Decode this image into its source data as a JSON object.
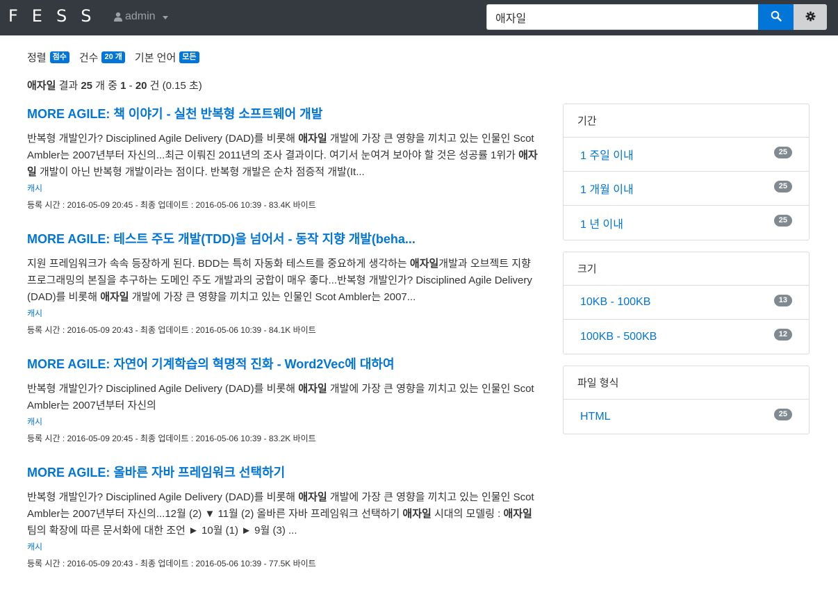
{
  "header": {
    "logo": "FESS",
    "user": "admin",
    "search_value": "애자일"
  },
  "filters": [
    {
      "label": "정렬",
      "badge": "점수"
    },
    {
      "label": "건수",
      "badge": "20 개"
    },
    {
      "label": "기본 언어",
      "badge": "모든"
    }
  ],
  "summary": {
    "query": "애자일",
    "text1": " 결과 ",
    "total": "25",
    "text2": " 개 중 ",
    "start": "1",
    "text3": " - ",
    "end": "20",
    "text4": " 건 (0.15 초)"
  },
  "results": [
    {
      "title": "MORE AGILE: 책 이야기 - 실천 반복형 소프트웨어 개발",
      "snippet": [
        {
          "t": "반복형 개발인가? Disciplined Agile Delivery (DAD)를 비롯해 "
        },
        {
          "t": "애자일",
          "b": true
        },
        {
          "t": " 개발에 가장 큰 영향을 끼치고 있는 인물인 Scot Ambler는 2007년부터 자신의...최근 이뤄진 2011년의 조사 결과이다. 여기서 눈여겨 보아야 할 것은 성공률 1위가 "
        },
        {
          "t": "애자일",
          "b": true
        },
        {
          "t": " 개발이 아닌 반복형 개발이라는 점이다. 반복형 개발은 순차 점증적 개발(It..."
        }
      ],
      "cache": "캐시",
      "meta": "등록 시간 : 2016-05-09 20:45 - 최종 업데이트 : 2016-05-06 10:39 - 83.4K 바이트"
    },
    {
      "title": "MORE AGILE: 테스트 주도 개발(TDD)을 넘어서 - 동작 지향 개발(beha...",
      "snippet": [
        {
          "t": "지원 프레임워크가 속속 등장하게 된다. BDD는 특히 자동화 테스트를 중요하게 생각하는 "
        },
        {
          "t": "애자일",
          "b": true
        },
        {
          "t": "개발과 오브젝트 지향 프로그래밍의 본질을 추구하는 도메인 주도 개발과의 궁합이 매우 좋다...반복형 개발인가? Disciplined Agile Delivery (DAD)를 비롯해 "
        },
        {
          "t": "애자일",
          "b": true
        },
        {
          "t": " 개발에 가장 큰 영향을 끼치고 있는 인물인 Scot Ambler는 2007..."
        }
      ],
      "cache": "캐시",
      "meta": "등록 시간 : 2016-05-09 20:43 - 최종 업데이트 : 2016-05-06 10:39 - 84.1K 바이트"
    },
    {
      "title": "MORE AGILE: 자연어 기계학습의 혁명적 진화 - Word2Vec에 대하여",
      "snippet": [
        {
          "t": "반복형 개발인가? Disciplined Agile Delivery (DAD)를 비롯해 "
        },
        {
          "t": "애자일",
          "b": true
        },
        {
          "t": " 개발에 가장 큰 영향을 끼치고 있는 인물인 Scot Ambler는 2007년부터 자신의"
        }
      ],
      "cache": "캐시",
      "meta": "등록 시간 : 2016-05-09 20:45 - 최종 업데이트 : 2016-05-06 10:39 - 83.2K 바이트"
    },
    {
      "title": "MORE AGILE: 올바른 자바 프레임워크 선택하기",
      "snippet": [
        {
          "t": "반복형 개발인가? Disciplined Agile Delivery (DAD)를 비롯해 "
        },
        {
          "t": "애자일",
          "b": true
        },
        {
          "t": " 개발에 가장 큰 영향을 끼치고 있는 인물인 Scot Ambler는 2007년부터 자신의...12월 (2) ▼ 11월 (2) 올바른 자바 프레임워크 선택하기 "
        },
        {
          "t": "애자일",
          "b": true
        },
        {
          "t": " 시대의 모델링 : "
        },
        {
          "t": "애자일",
          "b": true
        },
        {
          "t": " 팀의 확장에 따른 문서화에 대한 조언 ► 10월 (1) ► 9월 (3) ..."
        }
      ],
      "cache": "캐시",
      "meta": "등록 시간 : 2016-05-09 20:43 - 최종 업데이트 : 2016-05-06 10:39 - 77.5K 바이트"
    }
  ],
  "facets": [
    {
      "title": "기간",
      "items": [
        {
          "label": "1 주일 이내",
          "count": "25"
        },
        {
          "label": "1 개월 이내",
          "count": "25"
        },
        {
          "label": "1 년 이내",
          "count": "25"
        }
      ]
    },
    {
      "title": "크기",
      "items": [
        {
          "label": "10KB - 100KB",
          "count": "13"
        },
        {
          "label": "100KB - 500KB",
          "count": "12"
        }
      ]
    },
    {
      "title": "파일 형식",
      "items": [
        {
          "label": "HTML",
          "count": "25"
        }
      ]
    }
  ],
  "colors": {
    "accent": "#0275d8",
    "header_bg": "#343a40",
    "badge_gray": "#818a91"
  },
  "icons": {
    "user": "user-icon",
    "caret": "caret-down-icon",
    "search": "search-icon",
    "settings": "gear-icon"
  }
}
